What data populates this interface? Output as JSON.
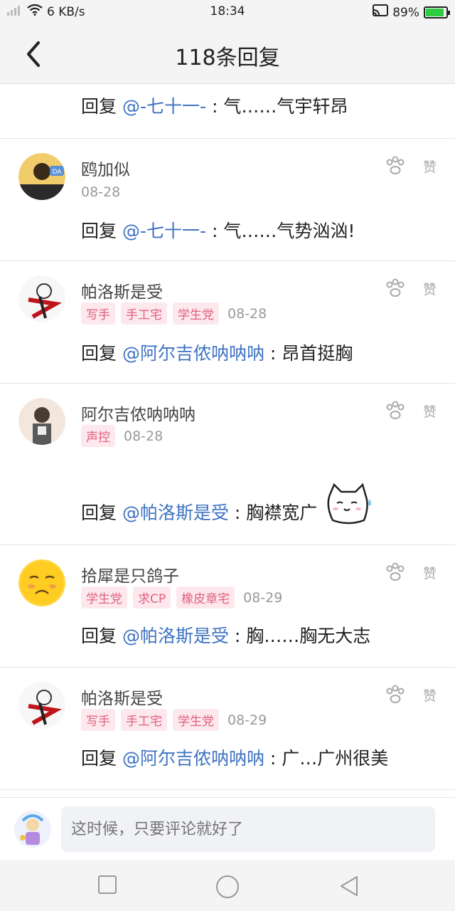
{
  "status": {
    "net": "6 KB/s",
    "time": "18:34",
    "battery": "89%"
  },
  "header": {
    "title": "118条回复"
  },
  "reply_prefix": "回复",
  "like_label": "赞",
  "comments": [
    {
      "reply_to": "@-七十一-",
      "text": " : 气……气宇轩昂"
    },
    {
      "name": "鸥加似",
      "tags": [],
      "date": "08-28",
      "reply_to": "@-七十一-",
      "text": " : 气……气势汹汹!"
    },
    {
      "name": "帕洛斯是受",
      "tags": [
        "写手",
        "手工宅",
        "学生党"
      ],
      "date": "08-28",
      "reply_to": "@阿尔吉侬呐呐呐",
      "text": " : 昂首挺胸"
    },
    {
      "name": "阿尔吉侬呐呐呐",
      "tags": [
        "声控"
      ],
      "date": "08-28",
      "reply_to": "@帕洛斯是受",
      "text": " : 胸襟宽广"
    },
    {
      "name": "拾犀是只鸽子",
      "tags": [
        "学生党",
        "求CP",
        "橡皮章宅"
      ],
      "date": "08-29",
      "reply_to": "@帕洛斯是受",
      "text": " : 胸……胸无大志"
    },
    {
      "name": "帕洛斯是受",
      "tags": [
        "写手",
        "手工宅",
        "学生党"
      ],
      "date": "08-29",
      "reply_to": "@阿尔吉侬呐呐呐",
      "text": " : 广…广州很美"
    }
  ],
  "input": {
    "placeholder": "这时候，只要评论就好了"
  }
}
